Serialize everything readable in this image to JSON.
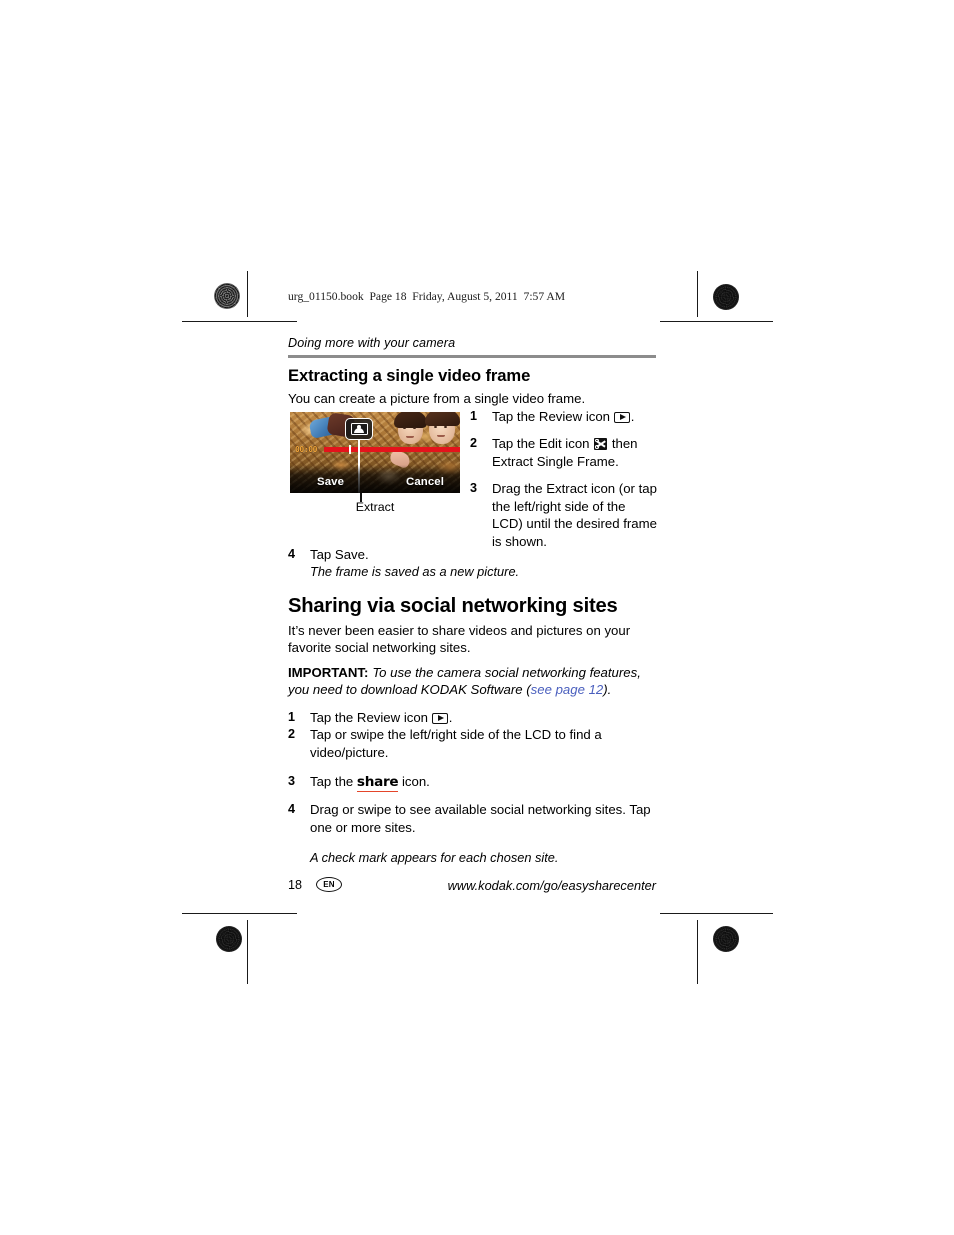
{
  "slug": "urg_01150.book  Page 18  Friday, August 5, 2011  7:57 AM",
  "running_head": "Doing more with your camera",
  "section1": {
    "heading": "Extracting a single video frame",
    "intro": "You can create a picture from a single video frame.",
    "figure": {
      "timestamp": "00:00",
      "softkey_save": "Save",
      "softkey_cancel": "Cancel",
      "caption": "Extract",
      "icon_badge": "extract-frame-icon"
    },
    "steps": [
      {
        "num": "1",
        "text_before": "Tap the Review icon ",
        "icon": "review-icon",
        "text_after": "."
      },
      {
        "num": "2",
        "text_before": "Tap the Edit icon ",
        "icon": "edit-scissors-icon",
        "text_after": " then Extract Single Frame."
      },
      {
        "num": "3",
        "text_before": "Drag the Extract icon (or tap the left/right side of the LCD) until the desired frame is shown.",
        "icon": "",
        "text_after": ""
      }
    ],
    "step4": {
      "num": "4",
      "text": "Tap Save.",
      "sub": "The frame is saved as a new picture."
    }
  },
  "section2": {
    "heading": "Sharing via social networking sites",
    "intro": "It’s never been easier to share videos and pictures on your favorite social networking sites.",
    "important_label": "IMPORTANT:",
    "important_text_before": "To use the camera social networking features, you need to download KODAK Software (",
    "important_link": "see page 12",
    "important_text_after": ").",
    "steps": [
      {
        "num": "1",
        "text_before": "Tap the Review icon ",
        "icon": "review-icon",
        "text_after": "."
      },
      {
        "num": "2",
        "text_before": "Tap or swipe the left/right side of the LCD to find a video/picture.",
        "icon": "",
        "text_after": ""
      },
      {
        "num": "3",
        "text_before": "Tap the ",
        "icon": "share-icon",
        "icon_label": "share",
        "text_after": " icon."
      },
      {
        "num": "4",
        "text_before": "Drag or swipe to see available social networking sites. Tap one or more sites.",
        "icon": "",
        "text_after": ""
      }
    ],
    "note": "A check mark appears for each chosen site."
  },
  "footer": {
    "page_number": "18",
    "language_badge": "EN",
    "url": "www.kodak.com/go/easysharecenter"
  },
  "colors": {
    "rule_gray": "#8c8c8c",
    "link_blue": "#4a5fbe",
    "share_underline": "#e4452a",
    "timeline_red": "#e4131c",
    "timestamp_orange": "#f2a53a"
  }
}
